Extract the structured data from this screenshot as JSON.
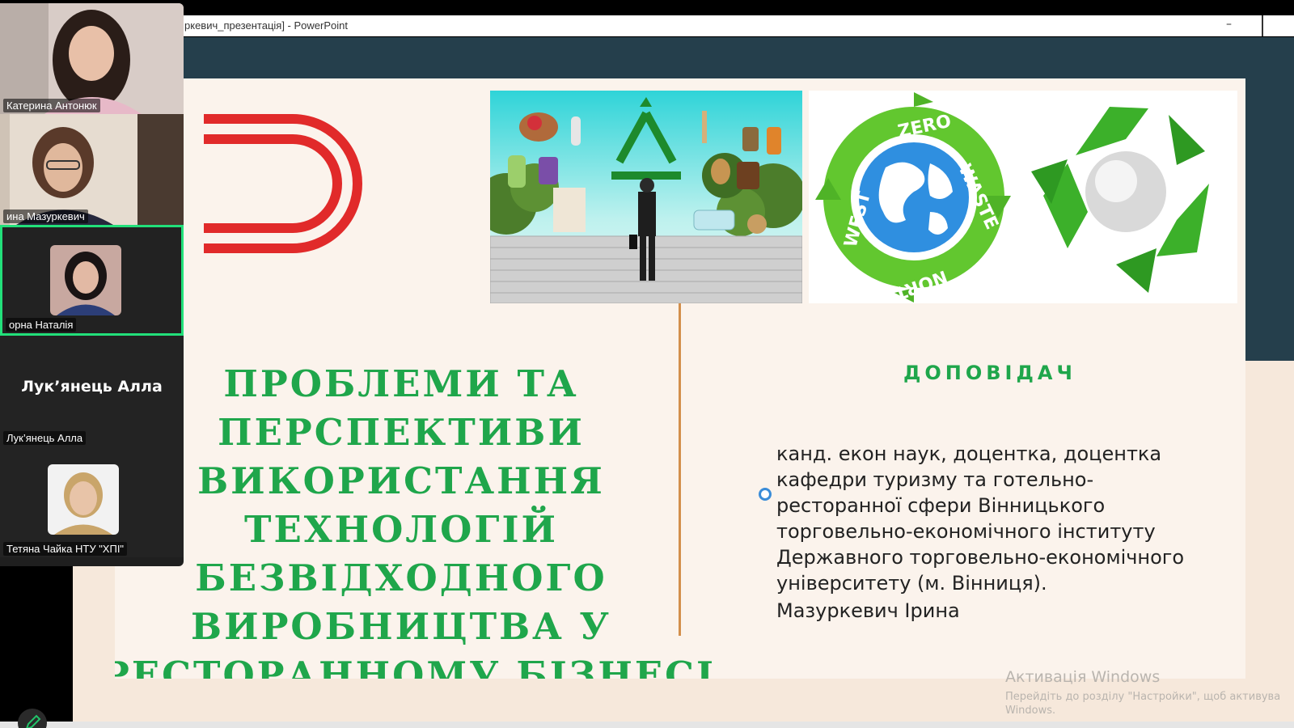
{
  "window": {
    "title": "ркевич_презентація] - PowerPoint",
    "minimize_label": "–"
  },
  "slide": {
    "title_lines": [
      "ПРОБЛЕМИ ТА",
      "ПЕРСПЕКТИВИ",
      "ВИКОРИСТАННЯ",
      "ТЕХНОЛОГІЙ",
      "БЕЗВІДХОДНОГО",
      "ВИРОБНИЦТВА У",
      "РЕСТОРАННОМУ БІЗНЕСІ"
    ],
    "speaker_heading": "ДОПОВІДАЧ",
    "speaker_description": "канд. екон наук, доцентка, доцентка\nкафедри туризму та готельно-\nресторанної сфери Вінницького\nторговельно-економічного інституту\nДержавного торговельно-економічного\nуніверситету (м. Вінниця).",
    "speaker_name": "Мазуркевич Ірина",
    "logo_words": {
      "top": "ZERO",
      "right": "WASTE",
      "bottom": "NORTH",
      "left": "WEST"
    },
    "colors": {
      "title_green": "#1fa64b",
      "divider": "#d38f4b",
      "dark_band": "#253f4c",
      "accent_red": "#e12a2a"
    }
  },
  "activation": {
    "title": "Активація Windows",
    "line1": "Перейдіть до розділу \"Настройки\", щоб активува",
    "line2": "Windows."
  },
  "participants": [
    {
      "name": "Катерина Антонюк",
      "type": "video"
    },
    {
      "name": "ина Мазуркевич",
      "type": "video"
    },
    {
      "name": "орна Наталія",
      "type": "avatar",
      "active": true
    },
    {
      "name": "Лук’янець Алла",
      "type": "text",
      "center_name": "Лук’янець Алла"
    },
    {
      "name": "Тетяна Чайка НТУ \"ХПІ\"",
      "type": "avatar"
    }
  ],
  "icons": {
    "edit": "pencil-icon"
  }
}
